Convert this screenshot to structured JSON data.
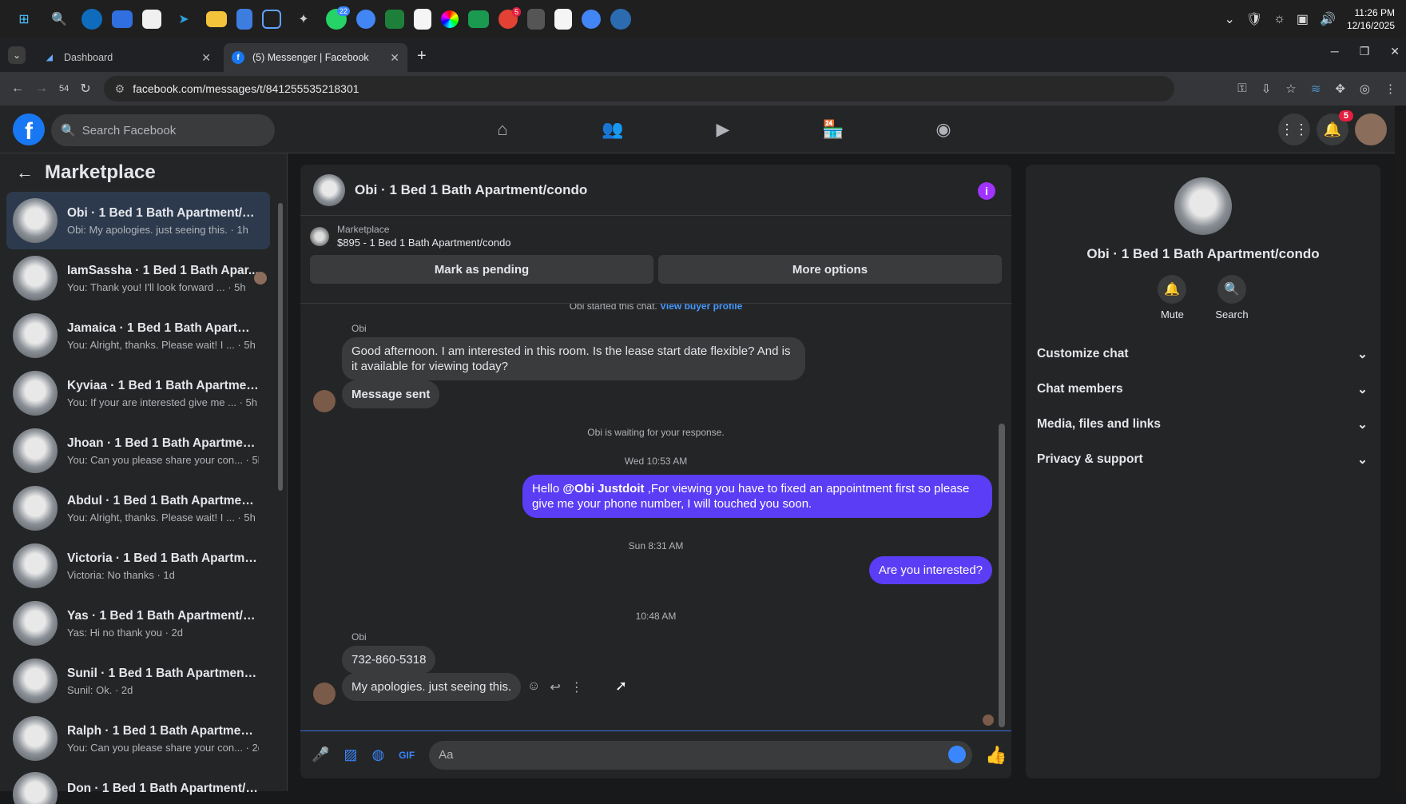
{
  "taskbar": {
    "icons": [
      "windows-icon",
      "search-icon",
      "edge-icon",
      "mail-icon",
      "store-icon",
      "telegram-icon",
      "folder-icon",
      "notepad-icon",
      "snip-icon",
      "app-icon",
      "whatsapp-icon",
      "chrome-icon",
      "vpn-icon",
      "finder-icon",
      "color-icon",
      "tripadvisor-icon",
      "chrome-icon",
      "calculator-icon",
      "finder-icon",
      "chrome-icon",
      "app-icon"
    ],
    "whatsapp_badge": "22",
    "chrome_badge": "5",
    "time": "11:26 PM",
    "date": "12/16/2025"
  },
  "browser": {
    "tabs": [
      {
        "title": "Dashboard",
        "active": false
      },
      {
        "title": "(5) Messenger | Facebook",
        "active": true
      }
    ],
    "url": "facebook.com/messages/t/841255535218301",
    "back_count": "54"
  },
  "facebook": {
    "search_placeholder": "Search Facebook",
    "notification_count": "5"
  },
  "sidebar": {
    "title": "Marketplace",
    "conversations": [
      {
        "name": "Obi · 1 Bed 1 Bath Apartment/co...",
        "snippet": "Obi: My apologies. just seeing this. · 1h",
        "selected": true
      },
      {
        "name": "IamSassha · 1 Bed 1 Bath Apar...",
        "snippet": "You: Thank you! I'll look forward ... · 5h"
      },
      {
        "name": "Jamaica · 1 Bed 1 Bath Apartmen...",
        "snippet": "You: Alright, thanks. Please wait! I ... · 5h"
      },
      {
        "name": "Kyviaa · 1 Bed 1 Bath Apartment/...",
        "snippet": "You: If your are interested give me ... · 5h"
      },
      {
        "name": "Jhoan · 1 Bed 1 Bath Apartment/...",
        "snippet": "You: Can you please share your con... · 5h"
      },
      {
        "name": "Abdul · 1 Bed 1 Bath Apartment/...",
        "snippet": "You: Alright, thanks. Please wait! I ... · 5h"
      },
      {
        "name": "Victoria · 1 Bed 1 Bath Apartmen...",
        "snippet": "Victoria: No thanks · 1d"
      },
      {
        "name": "Yas · 1 Bed 1 Bath Apartment/co...",
        "snippet": "Yas: Hi no thank you · 2d"
      },
      {
        "name": "Sunil · 1 Bed 1 Bath Apartment/c...",
        "snippet": "Sunil: Ok. · 2d"
      },
      {
        "name": "Ralph · 1 Bed 1 Bath Apartment/...",
        "snippet": "You: Can you please share your con... · 2d"
      },
      {
        "name": "Don · 1 Bed 1 Bath Apartment/c...",
        "snippet": ""
      }
    ]
  },
  "chat": {
    "title": "Obi · 1 Bed 1 Bath Apartment/condo",
    "marketplace_label": "Marketplace",
    "listing": "$895 - 1 Bed 1 Bath Apartment/condo",
    "mark_pending": "Mark as pending",
    "more_options": "More options",
    "started": "Obi started this chat.",
    "view_buyer": "View buyer profile",
    "sender1": "Obi",
    "msg1": "Good afternoon. I am interested in this room. Is the lease start date flexible? And is it available for viewing today?",
    "msg2": "Message sent",
    "waiting": "Obi is waiting for your response.",
    "time1": "Wed 10:53 AM",
    "out1_pre": "Hello ",
    "out1_mention": "@Obi Justdoit",
    "out1_post": " ,For viewing you have to fixed an appointment first so please give me your phone number, I will touched you soon.",
    "time2": "Sun 8:31 AM",
    "out2": "Are you interested?",
    "time3": "10:48 AM",
    "sender2": "Obi",
    "msg3": "732-860-5318",
    "msg4": "My apologies. just seeing this.",
    "composer_placeholder": "Aa"
  },
  "details": {
    "name": "Obi · 1 Bed 1 Bath Apartment/condo",
    "mute": "Mute",
    "search": "Search",
    "sections": [
      "Customize chat",
      "Chat members",
      "Media, files and links",
      "Privacy & support"
    ]
  }
}
